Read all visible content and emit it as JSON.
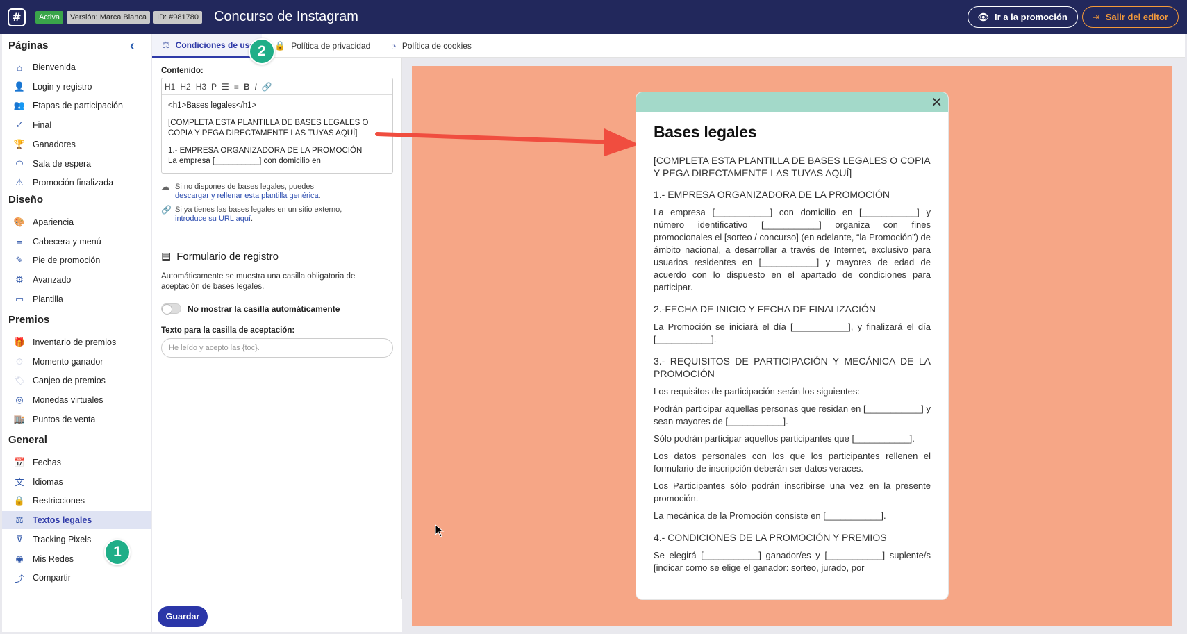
{
  "header": {
    "logo": "#",
    "status": "Activa",
    "version": "Versión: Marca Blanca",
    "id": "ID: #981780",
    "title": "Concurso de Instagram",
    "go_button": "Ir a la promoción",
    "exit_button": "Salir del editor"
  },
  "sidebar": {
    "sections": {
      "paginas": "Páginas",
      "diseno": "Diseño",
      "premios": "Premios",
      "general": "General"
    },
    "paginas": [
      "Bienvenida",
      "Login y registro",
      "Etapas de participación",
      "Final",
      "Ganadores",
      "Sala de espera",
      "Promoción finalizada"
    ],
    "diseno": [
      "Apariencia",
      "Cabecera y menú",
      "Pie de promoción",
      "Avanzado",
      "Plantilla"
    ],
    "premios": [
      "Inventario de premios",
      "Momento ganador",
      "Canjeo de premios",
      "Monedas virtuales",
      "Puntos de venta"
    ],
    "general": [
      "Fechas",
      "Idiomas",
      "Restricciones",
      "Textos legales",
      "Tracking Pixels",
      "Mis Redes",
      "Compartir"
    ]
  },
  "tabs": [
    "Condiciones de uso",
    "Política de privacidad",
    "Política de cookies"
  ],
  "steps": {
    "one": "1",
    "two": "2"
  },
  "editor": {
    "content_label": "Contenido:",
    "toolbar": [
      "H1",
      "H2",
      "H3",
      "P",
      "☰",
      "≡",
      "B",
      "I",
      "🔗"
    ],
    "body": [
      "<h1>Bases legales</h1>",
      "[COMPLETA ESTA PLANTILLA DE BASES LEGALES O COPIA Y PEGA DIRECTAMENTE LAS TUYAS AQUÍ]",
      "1.- EMPRESA ORGANIZADORA DE LA PROMOCIÓN",
      "La empresa [__________] con domicilio en"
    ],
    "hint1_text": "Si no dispones de bases legales, puedes",
    "hint1_link": "descargar y rellenar esta plantilla genérica",
    "hint2_text": "Si ya tienes las bases legales en un sitio externo,",
    "hint2_link": "introduce su URL aquí",
    "form_title": "Formulario de registro",
    "form_desc": "Automáticamente se muestra una casilla obligatoria de aceptación de bases legales.",
    "toggle_label": "No mostrar la casilla automáticamente",
    "accept_label": "Texto para la casilla de aceptación:",
    "accept_placeholder": "He leído y acepto las {toc}.",
    "save": "Guardar"
  },
  "preview": {
    "close": "✕",
    "title": "Bases legales",
    "lead": "[COMPLETA ESTA PLANTILLA DE BASES LEGALES O COPIA Y PEGA DIRECTAMENTE LAS TUYAS AQUÍ]",
    "h1": "1.- EMPRESA ORGANIZADORA DE LA PROMOCIÓN",
    "p1": "La empresa [___________] con domicilio en [___________] y número identificativo [___________] organiza con fines promocionales el [sorteo / concurso] (en adelante, “la Promoción”) de ámbito nacional, a desarrollar a través de Internet, exclusivo para usuarios residentes en [___________] y mayores de edad de acuerdo con lo dispuesto en el apartado de condiciones para participar.",
    "h2": "2.-FECHA DE INICIO Y FECHA DE FINALIZACIÓN",
    "p2": "La Promoción se iniciará el día [___________], y finalizará el día [___________].",
    "h3": "3.- REQUISITOS DE PARTICIPACIÓN Y MECÁNICA DE LA PROMOCIÓN",
    "p3a": "Los requisitos de participación serán los siguientes:",
    "p3b": "Podrán participar aquellas personas que residan en [___________] y sean mayores de [___________].",
    "p3c": "Sólo podrán participar aquellos participantes que [___________].",
    "p3d": "Los datos personales con los que los participantes rellenen el formulario de inscripción deberán ser datos veraces.",
    "p3e": "Los Participantes sólo podrán inscribirse una vez en la presente promoción.",
    "p3f": "La mecánica de la Promoción consiste en [___________].",
    "h4": "4.- CONDICIONES DE LA PROMOCIÓN Y PREMIOS",
    "p4": "Se elegirá [___________] ganador/es y [___________] suplente/s [indicar como se elige el ganador: sorteo, jurado, por"
  }
}
